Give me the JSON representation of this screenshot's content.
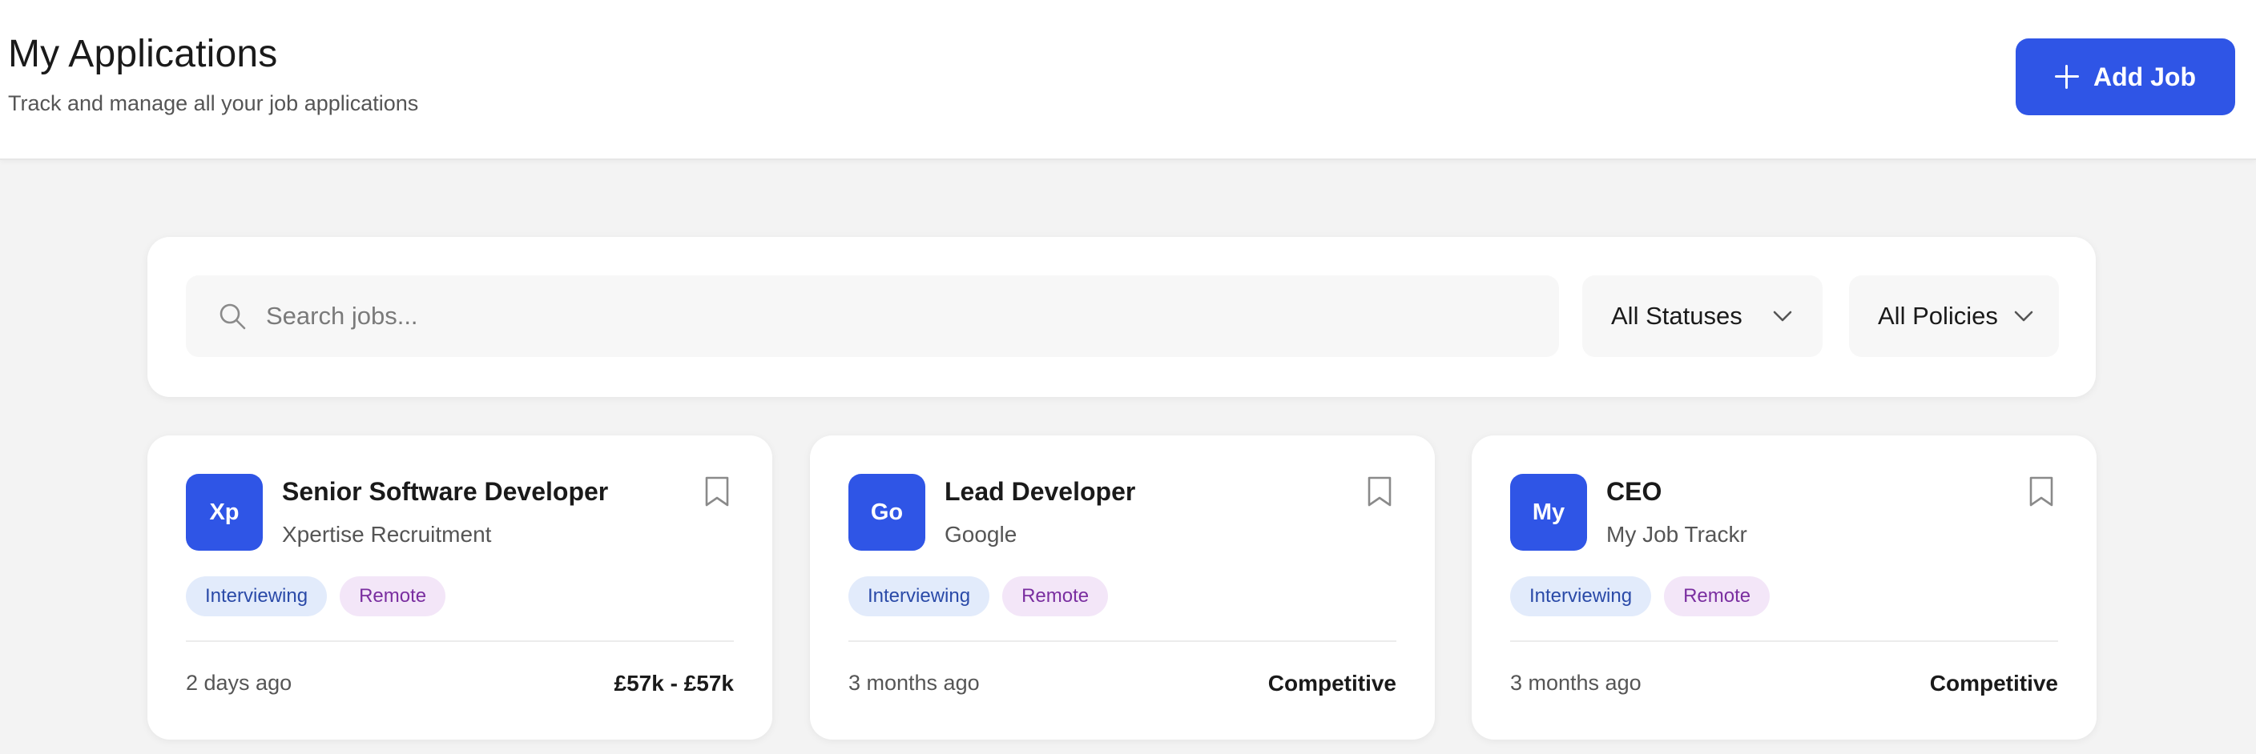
{
  "header": {
    "title": "My Applications",
    "subtitle": "Track and manage all your job applications",
    "add_button_label": "Add Job",
    "add_button_icon": "plus-icon"
  },
  "filters": {
    "search_placeholder": "Search jobs...",
    "search_value": "",
    "search_icon": "search-icon",
    "status_selected": "All Statuses",
    "policy_selected": "All Policies"
  },
  "jobs": [
    {
      "logo_initials": "Xp",
      "title": "Senior Software Developer",
      "company": "Xpertise Recruitment",
      "status": "Interviewing",
      "policy": "Remote",
      "posted": "2 days ago",
      "salary": "£57k - £57k"
    },
    {
      "logo_initials": "Go",
      "title": "Lead Developer",
      "company": "Google",
      "status": "Interviewing",
      "policy": "Remote",
      "posted": "3 months ago",
      "salary": "Competitive"
    },
    {
      "logo_initials": "My",
      "title": "CEO",
      "company": "My Job Trackr",
      "status": "Interviewing",
      "policy": "Remote",
      "posted": "3 months ago",
      "salary": "Competitive"
    }
  ],
  "colors": {
    "accent": "#2f55e6",
    "status_tag_bg": "#e2ebfb",
    "status_tag_text": "#2a4aa8",
    "policy_tag_bg": "#f3e6f8",
    "policy_tag_text": "#7a2ea0",
    "page_bg": "#f3f3f3"
  }
}
